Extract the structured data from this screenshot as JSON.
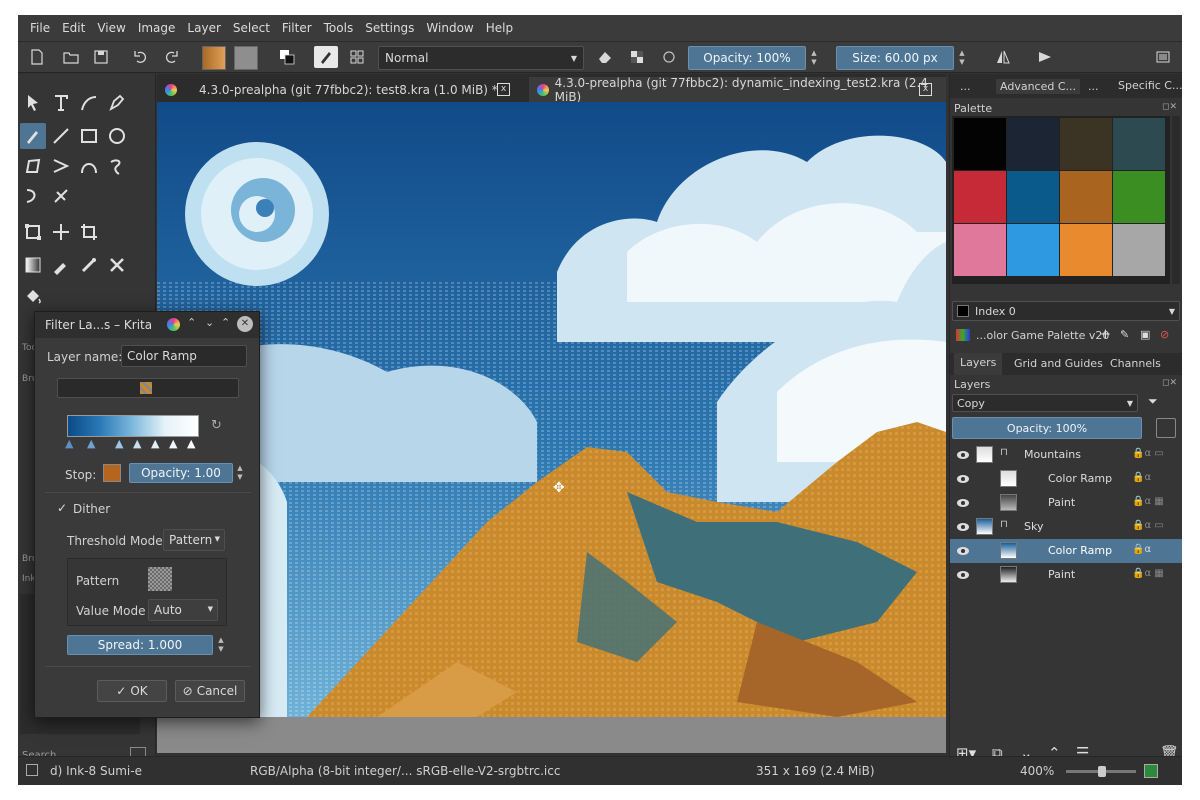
{
  "menubar": {
    "items": [
      "File",
      "Edit",
      "View",
      "Image",
      "Layer",
      "Select",
      "Filter",
      "Tools",
      "Settings",
      "Window",
      "Help"
    ]
  },
  "toolbar": {
    "blend_mode": "Normal",
    "opacity": "Opacity: 100%",
    "size": "Size: 60.00 px"
  },
  "toolbox": {
    "label_tool": "Too",
    "label_brush": "Bru",
    "label_brush2": "Bru",
    "label_ink": "Ink",
    "search_placeholder": "Search"
  },
  "tabs": [
    {
      "title": "4.3.0-prealpha (git 77fbbc2): test8.kra (1.0 MiB) *",
      "close": "x"
    },
    {
      "title": "4.3.0-prealpha (git 77fbbc2): dynamic_indexing_test2.kra (2.4 MiB)",
      "close": "x"
    }
  ],
  "docker": {
    "top_tabs": [
      "...",
      "Advanced C...",
      "...",
      "Specific C..."
    ],
    "palette_title": "Palette",
    "palette_colors": [
      "#030303",
      "#1b2533",
      "#3b3324",
      "#2c4a4f",
      "#c62a36",
      "#0a5a8c",
      "#a9651f",
      "#3a8e22",
      "#e0789b",
      "#2e98e0",
      "#e98a2f",
      "#a7a7a7"
    ],
    "index_label": "Index 0",
    "palette_name": "...olor Game Palette v20",
    "layer_tabs": [
      "Layers",
      "Grid and Guides",
      "Channels"
    ],
    "layers_title": "Layers",
    "blend_mode": "Copy",
    "layer_opacity": "Opacity:  100%",
    "layers": [
      {
        "name": "Mountains",
        "kind": "group"
      },
      {
        "name": "Color Ramp",
        "kind": "filter"
      },
      {
        "name": "Paint",
        "kind": "paint"
      },
      {
        "name": "Sky",
        "kind": "group"
      },
      {
        "name": "Color Ramp",
        "kind": "filter",
        "selected": true
      },
      {
        "name": "Paint",
        "kind": "paint"
      }
    ]
  },
  "dialog": {
    "title": "Filter La...s – Krita",
    "layer_name_label": "Layer name:",
    "layer_name_value": "Color Ramp",
    "stop_label": "Stop:",
    "stop_opacity": "Opacity: 1.00",
    "dither_label": "Dither",
    "threshold_label": "Threshold Mode",
    "threshold_value": "Pattern",
    "pattern_label": "Pattern",
    "value_mode_label": "Value Mode",
    "value_mode_value": "Auto",
    "spread": "Spread:  1.000",
    "ok": "OK",
    "cancel": "Cancel"
  },
  "statusbar": {
    "brush": "d) Ink-8 Sumi-e",
    "color_space": "RGB/Alpha (8-bit integer/... sRGB-elle-V2-srgbtrc.icc",
    "image_size": "351 x 169 (2.4 MiB)",
    "zoom": "400%"
  },
  "colors": {
    "accent": "#4f7595",
    "sky": "#1f5a92",
    "mountain": "#c98a2d",
    "background": "#323232"
  }
}
